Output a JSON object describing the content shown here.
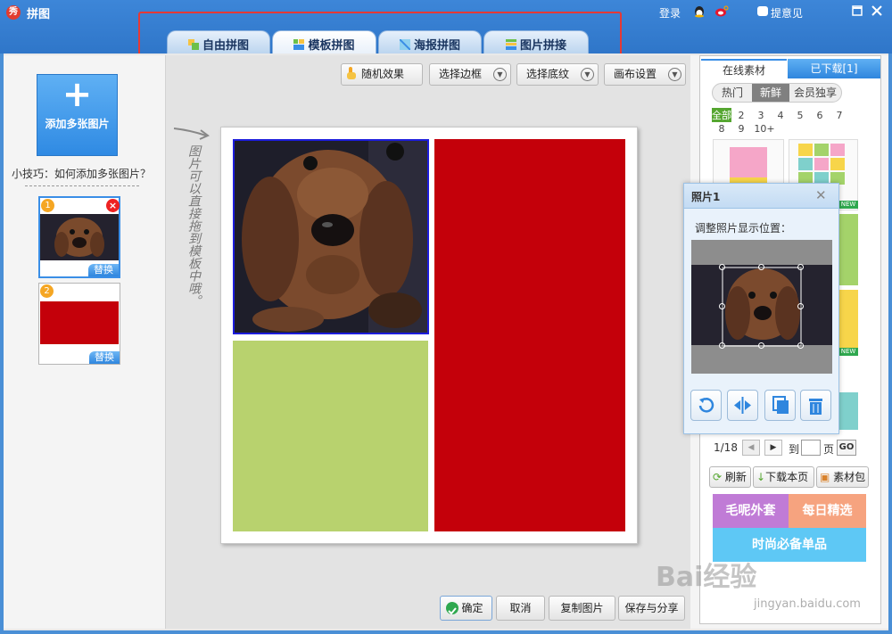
{
  "window": {
    "app_title": "拼图",
    "login": "登录",
    "feedback": "提意见",
    "colors": {
      "title_bar": "#3d86d8",
      "accent": "#2f86de",
      "highlight_box": "#e53935"
    }
  },
  "tabs": [
    {
      "label": "自由拼图",
      "active": false
    },
    {
      "label": "模板拼图",
      "active": true
    },
    {
      "label": "海报拼图",
      "active": false
    },
    {
      "label": "图片拼接",
      "active": false
    }
  ],
  "left_panel": {
    "add_label": "添加多张图片",
    "tip": "小技巧：如何添加多张图片？",
    "thumbs": [
      {
        "number": "1",
        "replace_label": "替换"
      },
      {
        "number": "2",
        "replace_label": "替换"
      }
    ]
  },
  "toolbar": {
    "random": "随机效果",
    "border": "选择边框",
    "texture": "选择底纹",
    "canvas": "画布设置"
  },
  "workspace": {
    "hint": "图片可以直接拖到模板中哦。",
    "cells": [
      {
        "name": "photo-cell-dog",
        "color": "#3a2418"
      },
      {
        "name": "cell-green",
        "color": "#b8d26e"
      },
      {
        "name": "cell-red",
        "color": "#c4000a"
      }
    ]
  },
  "bottom_buttons": {
    "ok": "确定",
    "cancel": "取消",
    "copy": "复制图片",
    "save": "保存与分享"
  },
  "right_panel": {
    "tab_online": "在线素材",
    "tab_downloaded": "已下载[1]",
    "filters": [
      "热门",
      "新鲜",
      "会员独享"
    ],
    "numbers_row1": [
      "全部",
      "2",
      "3",
      "4",
      "5",
      "6",
      "7"
    ],
    "numbers_row2": [
      "8",
      "9",
      "10+"
    ],
    "new_badge": "NEW",
    "pagination": {
      "current": "1/18",
      "to": "到",
      "page": "页",
      "go": "GO"
    },
    "actions": {
      "refresh": "刷新",
      "download_page": "下载本页",
      "pack": "素材包"
    },
    "ads": [
      "毛呢外套",
      "每日精选",
      "时尚必备单品"
    ]
  },
  "photo_popup": {
    "title": "照片1",
    "instruction": "调整照片显示位置：",
    "tools": [
      "rotate",
      "flip",
      "copy",
      "delete"
    ]
  },
  "watermark": {
    "text": "Bai经验",
    "url": "jingyan.baidu.com"
  }
}
